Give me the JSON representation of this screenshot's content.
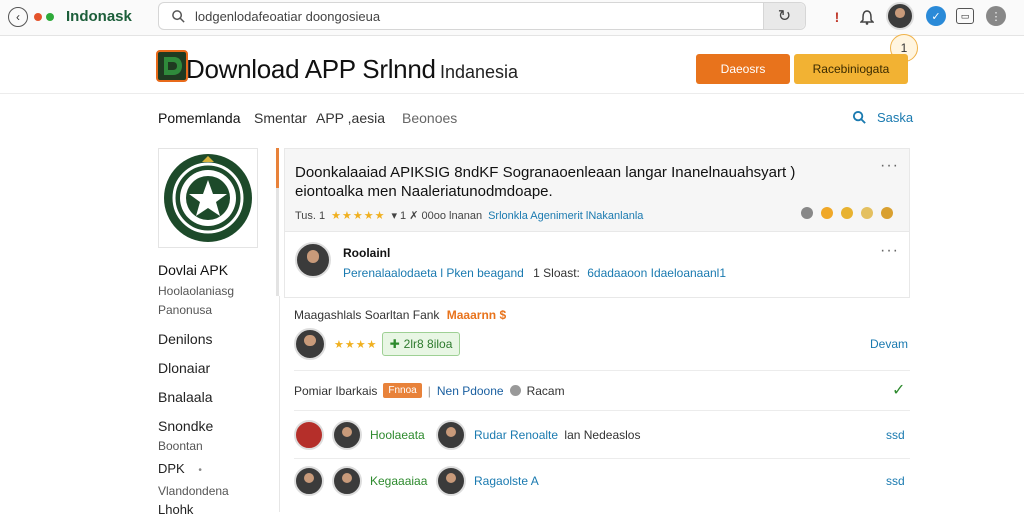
{
  "browser": {
    "site_label": "Indonask",
    "address": "lodgenlodafeoatiar doongosieua",
    "tooltip_label": "1"
  },
  "header": {
    "title": "Download APP Srlnnd",
    "country": "Indanesia",
    "btn_primary": "Daeosrs",
    "btn_secondary": "Racebiniogata"
  },
  "nav": {
    "items": [
      "Pomemlanda",
      "Smentar",
      "APP ,aesia",
      "Beonoes"
    ],
    "search_label": "Saska"
  },
  "sidebar": {
    "title": "Dovlai APK",
    "sub1": "Hoolaolaniasg",
    "sub2": "Panonusa",
    "items": [
      "Denilons",
      "Dlonaiar",
      "Bnalaala",
      "Snondke"
    ],
    "sub3": "Boontan",
    "dpk": "DPK",
    "bullet": "•",
    "sub4": "Vlandondena",
    "last": "Lhohk"
  },
  "app_card": {
    "title_line1": "Doonkalaaiad APIKSIG 8ndKF Sogranaoenleaan langar Inanelnauahsyart )",
    "title_line2": "eiontoalka men Naaleriatunodmdoape.",
    "meta_prefix": "Tus. 1",
    "stars": "★★★★★",
    "meta_mid": "▾  1  ✗  00oo lnanan",
    "meta_link": "Srlonkla Agenimerit lNakanlanla",
    "more": "···"
  },
  "publisher": {
    "name": "Roolainl",
    "line_a": "Perenalaalodaeta l Pken beagand",
    "line_b": "1 Sloast:",
    "line_c": "6dadaaoon Idaeloanaanl1",
    "more": "···"
  },
  "rating_row": {
    "label": "Maagashlals Soarltan Fank",
    "label_highlight": "Maaarnn $",
    "stars": "★★★★",
    "chip_text": "2lr8 8iloa",
    "chip_icon": "✚",
    "right_link": "Devam"
  },
  "info_row": {
    "label": "Pomiar Ibarkais",
    "chip": "Fnnoa",
    "sep": "|",
    "link": "Nen Pdoone",
    "tail": "Racam",
    "check": "✓"
  },
  "list_rows": [
    {
      "name": "Hoolaeata",
      "desc_link": "Rudar Renoalte",
      "desc_tail": "lan Nedeaslos",
      "right": "ssd"
    },
    {
      "name": "Kegaaaiaa",
      "desc_link": "Ragaolste A",
      "desc_tail": "",
      "right": "ssd"
    }
  ],
  "colors": {
    "accent_orange": "#e8731c",
    "accent_amber": "#f2b233",
    "link_blue": "#1a7ab0",
    "green": "#2d8a2d",
    "logo_green": "#1f3a21"
  }
}
